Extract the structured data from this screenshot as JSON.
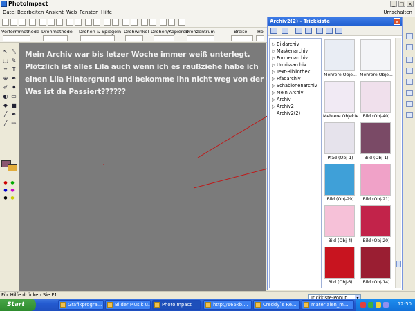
{
  "app": {
    "title": "PhotoImpact"
  },
  "menu": [
    "Datei",
    "Bearbeiten",
    "Ansicht",
    "Web",
    "Fenster",
    "Hilfe"
  ],
  "menu_right": "Umschalten",
  "toolbar2": {
    "labels": [
      "Verformmethode",
      "Drehmethode",
      "Drehen & Spiegeln",
      "Drehwinkel",
      "Drehen/Kopieren",
      "Drehzentrum",
      "Breite",
      "Hö"
    ]
  },
  "canvas": {
    "message": [
      "Mein Archiv war bis letzer  Woche immer weiß unterlegt.",
      "Plötzlich ist alles   Lila auch wenn ich es raußziehe habe ich",
      "einen Lila Hintergrund und bekomme ihn nicht weg von der Grafik.",
      "Was ist da Passiert??????"
    ],
    "background": "#7b7b7b"
  },
  "panel": {
    "title": "Archiv2(2) - Trickkiste",
    "tree": [
      "Bildarchiv",
      "Maskenarchiv",
      "Formenarchiv",
      "Umrissarchiv",
      "Text-Bibliothek",
      "Pfadarchiv",
      "Schablonenarchiv",
      "Mein Archiv",
      "Archiv",
      "Archiv2",
      "Archiv2(2)"
    ],
    "items": [
      {
        "label": "Mehrere Obje...",
        "color": "#e9edf4"
      },
      {
        "label": "Mehrere Obje...",
        "color": "#f3f4f7"
      },
      {
        "label": "Mehrere Objekte...",
        "color": "#f1eaf4"
      },
      {
        "label": "Bild (Obj-40)",
        "color": "#f0e0ec"
      },
      {
        "label": "Pfad (Obj-1)",
        "color": "#e6e3ec"
      },
      {
        "label": "Bild (Obj-1)",
        "color": "#7a4a66"
      },
      {
        "label": "Bild (Obj-29)",
        "color": "#3fa0d8"
      },
      {
        "label": "Bild (Obj-21)",
        "color": "#f0a2c8"
      },
      {
        "label": "Bild (Obj-4)",
        "color": "#f6c1d8"
      },
      {
        "label": "Bild (Obj-20)",
        "color": "#c2234a"
      },
      {
        "label": "Bild (Obj-6)",
        "color": "#c8141f"
      },
      {
        "label": "Bild (Obj-14)",
        "color": "#9a1e32"
      }
    ]
  },
  "status": {
    "text": "Für Hilfe drücken Sie F1.",
    "popup": "Trickkiste-Popup"
  },
  "taskbar": {
    "start": "Start",
    "tasks": [
      "Grafikprogra...",
      "Bilder Musik u...",
      "PhotoImpact",
      "http://666kb....",
      "Creddy`s Re...",
      "materialen_m..."
    ],
    "clock": "12:50"
  },
  "colors": {
    "foreground_swatch": "#8a5670",
    "background_swatch": "#e2ad3c",
    "titlebar": "#2a5fd1",
    "taskbar": "#245bd0"
  }
}
